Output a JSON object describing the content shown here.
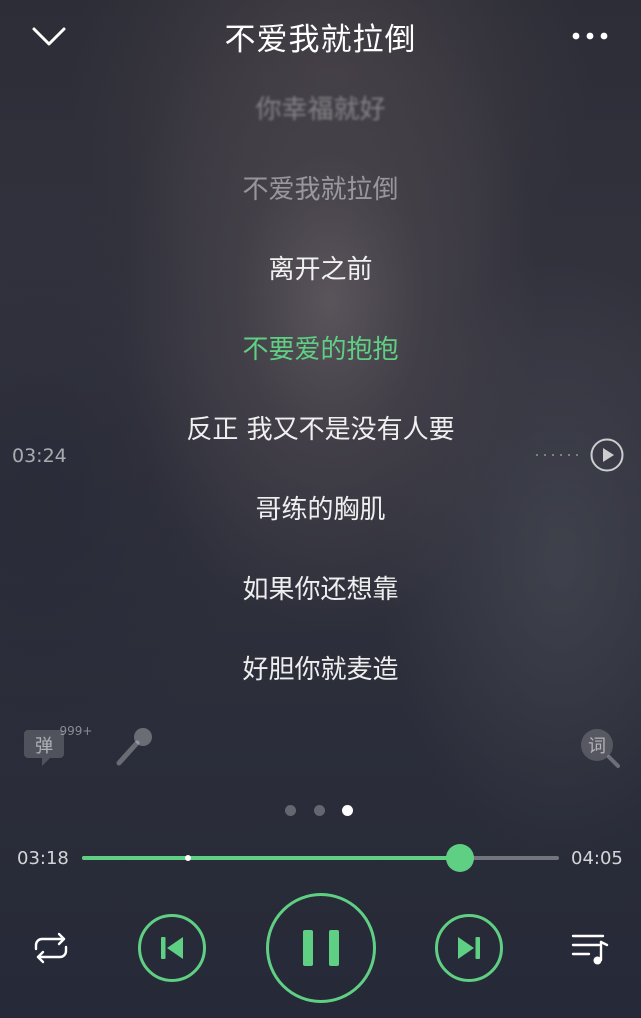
{
  "header": {
    "title": "不爱我就拉倒",
    "back_icon": "chevron-down-icon",
    "more_icon": "more-dots-icon"
  },
  "lyrics": {
    "lines": [
      {
        "text": "你幸福就好",
        "state": "faded"
      },
      {
        "text": "不爱我就拉倒",
        "state": "dim"
      },
      {
        "text": "离开之前",
        "state": "normal"
      },
      {
        "text": "不要爱的抱抱",
        "state": "active"
      },
      {
        "text": "反正 我又不是没有人要",
        "state": "normal"
      },
      {
        "text": "哥练的胸肌",
        "state": "normal"
      },
      {
        "text": "如果你还想靠",
        "state": "normal"
      },
      {
        "text": "好胆你就麦造",
        "state": "normal"
      }
    ],
    "active_main": "不要爱的抱抱",
    "active_tail": ""
  },
  "scrub": {
    "time": "03:24",
    "play_icon": "play-circle-icon"
  },
  "tools": {
    "danmaku_icon_label": "弹",
    "danmaku_count": "999+",
    "mic_icon": "microphone-icon",
    "lyric_icon_label": "词"
  },
  "pager": {
    "count": 3,
    "active_index": 2
  },
  "progress": {
    "current": "03:18",
    "total": "04:05",
    "fraction": 0.793,
    "marker_fraction": 0.222
  },
  "controls": {
    "repeat_icon": "repeat-icon",
    "prev_icon": "skip-previous-icon",
    "pause_icon": "pause-icon",
    "next_icon": "skip-next-icon",
    "playlist_icon": "playlist-icon"
  },
  "colors": {
    "accent": "#5fcf83",
    "text": "#ffffff"
  }
}
